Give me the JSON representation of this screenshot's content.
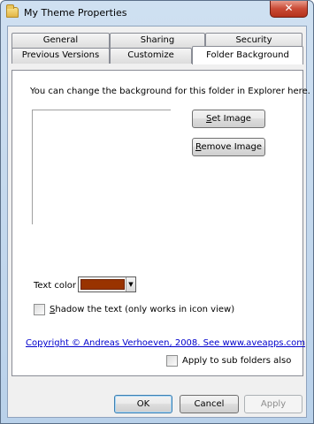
{
  "window": {
    "title": "My Theme Properties",
    "close_glyph": "✕"
  },
  "tabs": {
    "row_back": [
      "General",
      "Sharing",
      "Security"
    ],
    "row_front": [
      "Previous Versions",
      "Customize",
      "Folder Background"
    ],
    "active": "Folder Background"
  },
  "panel": {
    "description": "You can change the background for this folder in Explorer here.",
    "set_image_prefix": "S",
    "set_image_rest": "et Image",
    "remove_image_prefix": "R",
    "remove_image_rest": "emove Image",
    "text_color_label": "Text color",
    "text_color_value": "#993300",
    "shadow_prefix": "S",
    "shadow_rest": "hadow the text (only works in icon view)",
    "shadow_checked": false,
    "apply_sub_label": "Apply to sub folders also",
    "apply_sub_checked": false,
    "copyright_link": "Copyright © Andreas Verhoeven, 2008. See www.aveapps.com"
  },
  "footer": {
    "ok_label": "OK",
    "cancel_label": "Cancel",
    "apply_label": "Apply"
  },
  "icons": {
    "window_icon": "folder-icon",
    "close": "close-icon",
    "dropdown": "chevron-down-icon"
  },
  "colors": {
    "title_bar": "#b9d1ea",
    "selected_color_swatch": "#993300",
    "link": "#0000cc"
  }
}
